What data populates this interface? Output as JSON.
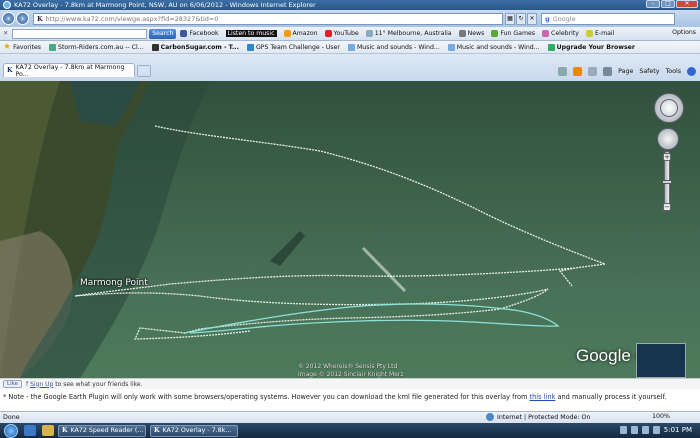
{
  "window": {
    "title": "KA72 Overlay - 7.8km at Marmong Point, NSW, AU on 6/06/2012 - Windows Internet Explorer"
  },
  "address": {
    "url": "http://www.ka72.com/viewge.aspx?fid=28327&tid=0",
    "search_placeholder": "Google"
  },
  "toolbar": {
    "search_button": "Search",
    "items": [
      "Facebook",
      "Listen to music",
      "Amazon",
      "YouTube",
      "11° Melbourne, Australia",
      "News",
      "Fun Games",
      "Celebrity",
      "E-mail"
    ],
    "options": "Options"
  },
  "favorites": {
    "label": "Favorites",
    "items": [
      "Storm-Riders.com.au -- Cl...",
      "CarbonSugar.com - T...",
      "GPS Team Challenge - User",
      "Music and sounds - Wind...",
      "Music and sounds - Wind...",
      "Upgrade Your Browser"
    ]
  },
  "tab": {
    "label": "KA72 Overlay - 7.8km at Marmong Po..."
  },
  "commandbar": {
    "page": "Page",
    "safety": "Safety",
    "tools": "Tools"
  },
  "map": {
    "place_label": "Marmong Point",
    "copyright_1": "© 2012 Whereis® Sensis Pty Ltd",
    "copyright_2": "Image © 2012 Sinclair Knight Merz",
    "brand": "Google earth"
  },
  "likebar": {
    "like_button": "Like",
    "signup": "Sign Up",
    "signup_rest": "to see what your friends like."
  },
  "note": {
    "text_before": "* Note - the Google Earth Plugin will only work with some browsers/operating systems. However you can download the kml file generated for this overlay from ",
    "link": "this link",
    "text_after": " and manually process it yourself."
  },
  "status": {
    "left": "Done",
    "zone": "Internet | Protected Mode: On",
    "zoom": "100%"
  },
  "taskbar": {
    "tasks": [
      "KA72 Speed Reader (...",
      "KA72 Overlay - 7.8k..."
    ],
    "clock": "5:01 PM"
  },
  "colors": {
    "track_white": "#e9efe9",
    "track_cyan": "#8fe0d8",
    "ie_blue": "#2b5787"
  }
}
